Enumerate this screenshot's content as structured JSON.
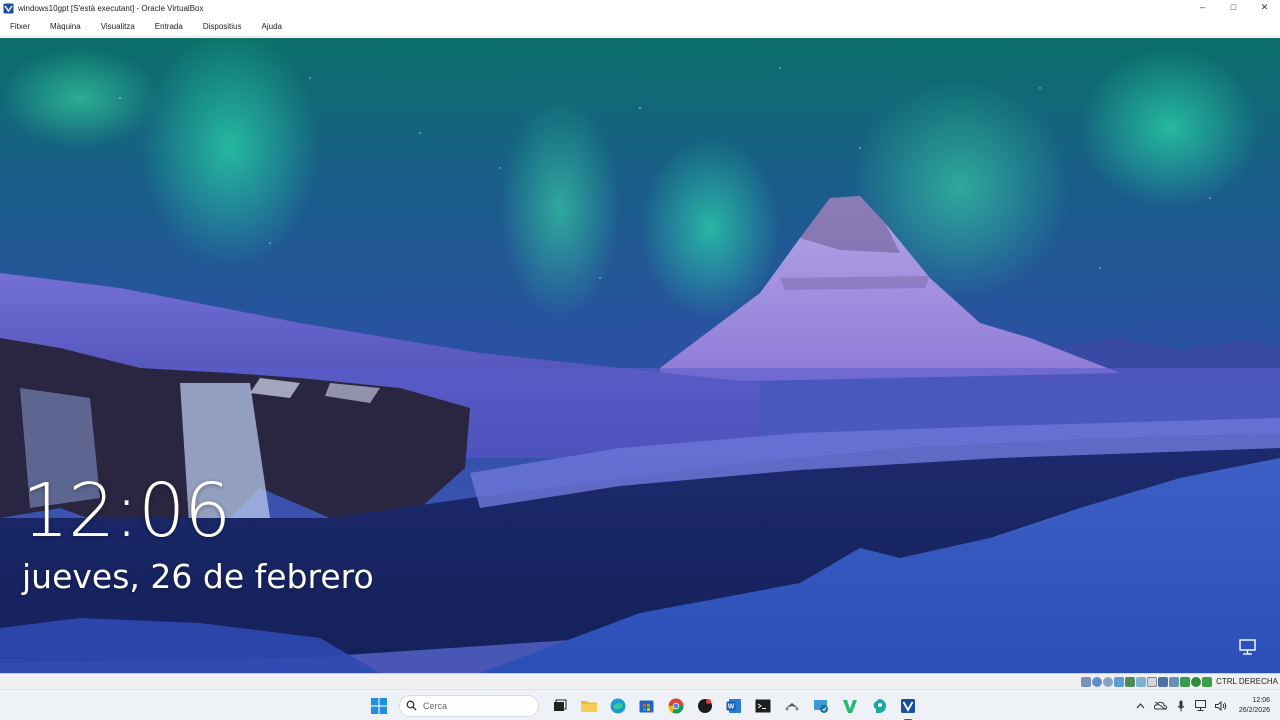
{
  "window": {
    "title": "windows10gpt [S'està executant] - Oracle VirtualBox",
    "controls": [
      {
        "name": "minimize",
        "glyph": "–"
      },
      {
        "name": "maximize",
        "glyph": "□"
      },
      {
        "name": "close",
        "glyph": "✕"
      }
    ]
  },
  "menubar": {
    "items": [
      "Fitxer",
      "Màquina",
      "Visualitza",
      "Entrada",
      "Dispositius",
      "Ajuda"
    ]
  },
  "lockscreen": {
    "time": "12:06",
    "date": "jueves, 26 de febrero",
    "network_icon": "network-icon"
  },
  "vbox_status": {
    "host_key": "CTRL DERECHA",
    "icons": [
      "hard-disk-icon",
      "optical-drive-icon",
      "audio-icon",
      "network-adapter-icon",
      "usb-icon",
      "shared-folders-icon",
      "display-icon",
      "recording-icon",
      "cpu-icon",
      "guest-additions-icon",
      "mouse-integration-icon",
      "keyboard-icon"
    ]
  },
  "taskbar": {
    "search_placeholder": "Cerca",
    "apps": [
      {
        "name": "start-button",
        "icon": "windows-logo-icon"
      },
      {
        "name": "task-view-button",
        "icon": "task-view-icon"
      },
      {
        "name": "file-explorer-button",
        "icon": "folder-icon"
      },
      {
        "name": "edge-button",
        "icon": "edge-icon"
      },
      {
        "name": "store-button",
        "icon": "store-icon"
      },
      {
        "name": "chrome-button",
        "icon": "chrome-icon"
      },
      {
        "name": "app-black-button",
        "icon": "app-icon"
      },
      {
        "name": "word-button",
        "icon": "word-icon"
      },
      {
        "name": "terminal-button",
        "icon": "terminal-icon"
      },
      {
        "name": "drone-app-button",
        "icon": "drone-icon"
      },
      {
        "name": "remote-app-button",
        "icon": "remote-desktop-icon"
      },
      {
        "name": "v-app-button",
        "icon": "v-icon"
      },
      {
        "name": "teal-app-button",
        "icon": "teal-app-icon"
      },
      {
        "name": "virtualbox-button",
        "icon": "virtualbox-icon"
      }
    ],
    "clock_time": "12:06",
    "clock_date": "26/2/2026"
  }
}
